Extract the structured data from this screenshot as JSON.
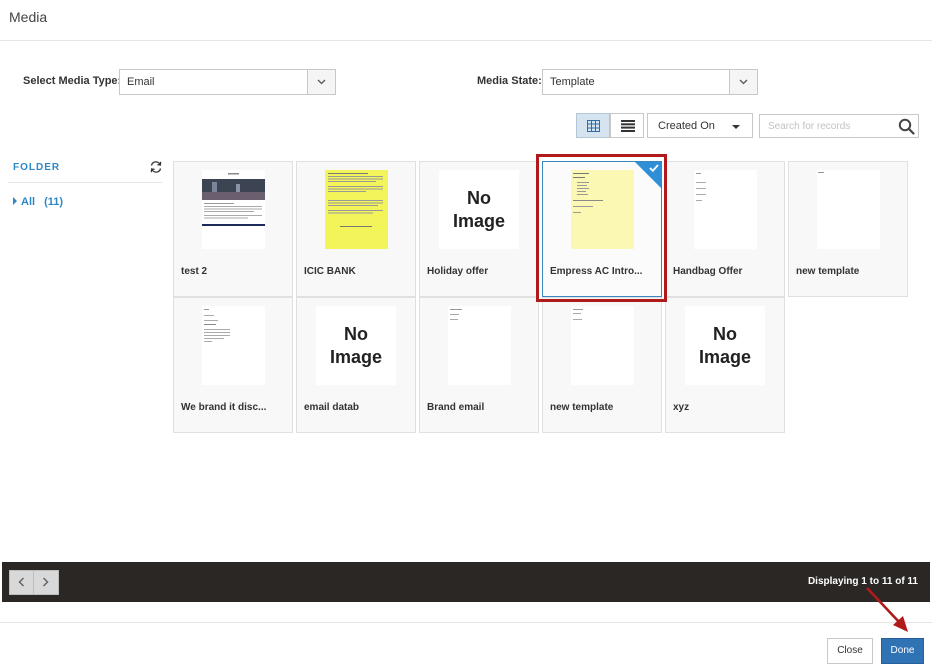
{
  "header": {
    "title": "Media"
  },
  "filters": {
    "media_type_label": "Select Media Type:",
    "media_type_value": "Email",
    "media_state_label": "Media State:",
    "media_state_value": "Template"
  },
  "toolbar": {
    "sort_value": "Created On",
    "search_placeholder": "Search for records",
    "active_view": "grid"
  },
  "folder": {
    "title": "FOLDER",
    "all_label": "All",
    "all_count": "(11)"
  },
  "no_image_text": {
    "line1": "No",
    "line2": "Image"
  },
  "cards": [
    {
      "name": "test 2",
      "thumb": "document"
    },
    {
      "name": "ICIC BANK",
      "thumb": "yellow-doc"
    },
    {
      "name": "Holiday offer",
      "thumb": "no-image"
    },
    {
      "name": "Empress AC Intro...",
      "thumb": "pale-doc",
      "selected": true
    },
    {
      "name": "Handbag Offer",
      "thumb": "document"
    },
    {
      "name": "new template",
      "thumb": "document"
    },
    {
      "name": "We brand it disc...",
      "thumb": "document"
    },
    {
      "name": "email datab",
      "thumb": "no-image"
    },
    {
      "name": "Brand email",
      "thumb": "document"
    },
    {
      "name": "new template",
      "thumb": "document"
    },
    {
      "name": "xyz",
      "thumb": "no-image"
    }
  ],
  "pagination": {
    "display_text": "Displaying 1 to 11 of 11"
  },
  "footer": {
    "close_label": "Close",
    "done_label": "Done"
  },
  "colors": {
    "accent": "#2f88c6",
    "primary_button": "#2f73b5",
    "highlight": "#b01a1a",
    "bar": "#2b2724",
    "selected_check": "#2f8fd6"
  }
}
